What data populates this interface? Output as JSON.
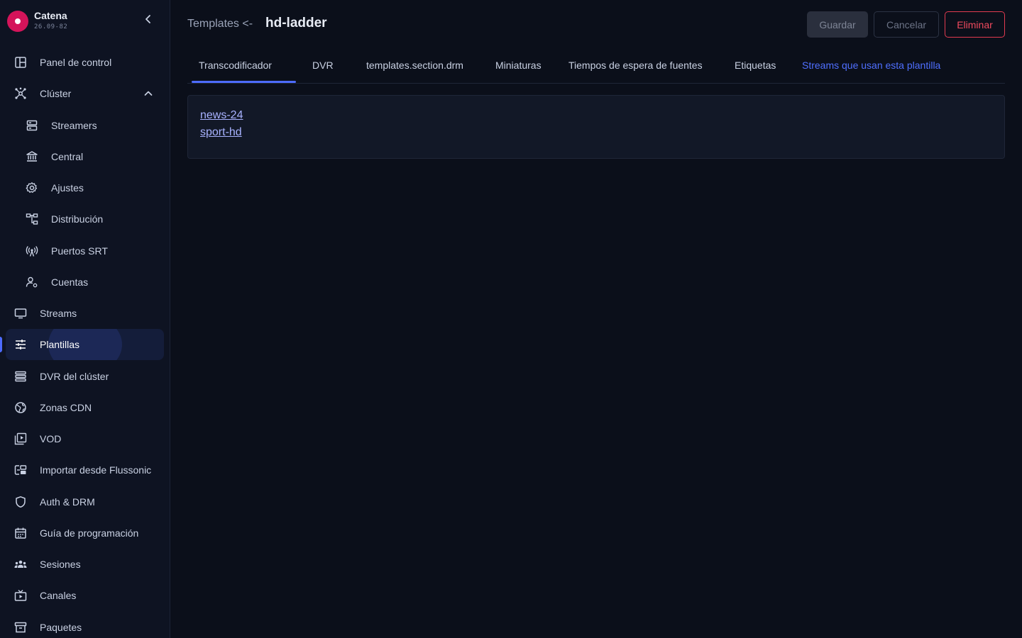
{
  "brand": {
    "name": "Catena",
    "version": "26.09-82"
  },
  "sidebar": {
    "items": [
      {
        "label": "Panel de control",
        "icon": "dashboard-icon"
      },
      {
        "label": "Clúster",
        "icon": "cluster-icon",
        "expanded": true
      },
      {
        "label": "Streamers",
        "icon": "server-icon"
      },
      {
        "label": "Central",
        "icon": "bank-icon"
      },
      {
        "label": "Ajustes",
        "icon": "gear-icon"
      },
      {
        "label": "Distribución",
        "icon": "tree-icon"
      },
      {
        "label": "Puertos SRT",
        "icon": "antenna-icon"
      },
      {
        "label": "Cuentas",
        "icon": "user-settings-icon"
      },
      {
        "label": "Streams",
        "icon": "monitor-icon"
      },
      {
        "label": "Plantillas",
        "icon": "sliders-icon",
        "active": true
      },
      {
        "label": "DVR del clúster",
        "icon": "storage-icon"
      },
      {
        "label": "Zonas CDN",
        "icon": "globe-icon"
      },
      {
        "label": "VOD",
        "icon": "video-library-icon"
      },
      {
        "label": "Importar desde Flussonic",
        "icon": "import-icon"
      },
      {
        "label": "Auth & DRM",
        "icon": "shield-icon"
      },
      {
        "label": "Guía de programación",
        "icon": "calendar-icon"
      },
      {
        "label": "Sesiones",
        "icon": "users-icon"
      },
      {
        "label": "Canales",
        "icon": "tv-icon"
      },
      {
        "label": "Paquetes",
        "icon": "archive-icon"
      }
    ]
  },
  "header": {
    "breadcrumb": "Templates <-",
    "title": "hd-ladder",
    "save_label": "Guardar",
    "cancel_label": "Cancelar",
    "delete_label": "Eliminar"
  },
  "tabs": [
    {
      "label": "Transcodificador",
      "active": true
    },
    {
      "label": "DVR"
    },
    {
      "label": "templates.section.drm"
    },
    {
      "label": "Miniaturas"
    },
    {
      "label": "Tiempos de espera de fuentes"
    },
    {
      "label": "Etiquetas"
    },
    {
      "label": "Streams que usan esta plantilla"
    }
  ],
  "streams_using_template": [
    "news-24",
    "sport-hd"
  ],
  "colors": {
    "accent": "#4d6bff",
    "danger": "#f04a5e",
    "brand": "#d4145a",
    "background": "#0b0f1a",
    "sidebar": "#0e1322"
  }
}
